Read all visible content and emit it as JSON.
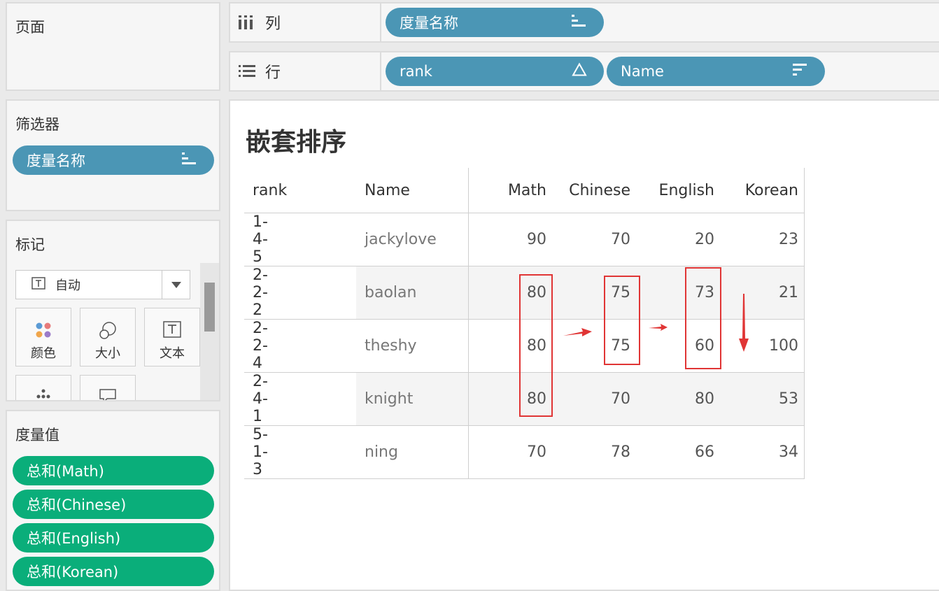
{
  "pages_panel": {
    "title": "页面"
  },
  "filters_panel": {
    "title": "筛选器",
    "pill": "度量名称"
  },
  "marks_panel": {
    "title": "标记",
    "mark_type": "自动",
    "buttons": [
      "颜色",
      "大小",
      "文本"
    ]
  },
  "measure_values_panel": {
    "title": "度量值",
    "pills": [
      "总和(Math)",
      "总和(Chinese)",
      "总和(English)",
      "总和(Korean)"
    ]
  },
  "columns_shelf": {
    "label": "列",
    "pills": [
      "度量名称"
    ]
  },
  "rows_shelf": {
    "label": "行",
    "pills": [
      "rank",
      "Name"
    ]
  },
  "viz": {
    "title": "嵌套排序",
    "headers": [
      "rank",
      "Name",
      "Math",
      "Chinese",
      "English",
      "Korean"
    ],
    "rows": [
      {
        "rank": "1-4-5",
        "name": "jackylove",
        "values": [
          "90",
          "70",
          "20",
          "23"
        ]
      },
      {
        "rank": "2-2-2",
        "name": "baolan",
        "values": [
          "80",
          "75",
          "73",
          "21"
        ]
      },
      {
        "rank": "2-2-4",
        "name": "theshy",
        "values": [
          "80",
          "75",
          "60",
          "100"
        ]
      },
      {
        "rank": "2-4-1",
        "name": "knight",
        "values": [
          "80",
          "70",
          "80",
          "53"
        ]
      },
      {
        "rank": "5-1-3",
        "name": "ning",
        "values": [
          "70",
          "78",
          "66",
          "34"
        ]
      }
    ]
  },
  "colors": {
    "blue_pill": "#4b96b5",
    "green_pill": "#0aae7a",
    "highlight": "#e03535"
  }
}
